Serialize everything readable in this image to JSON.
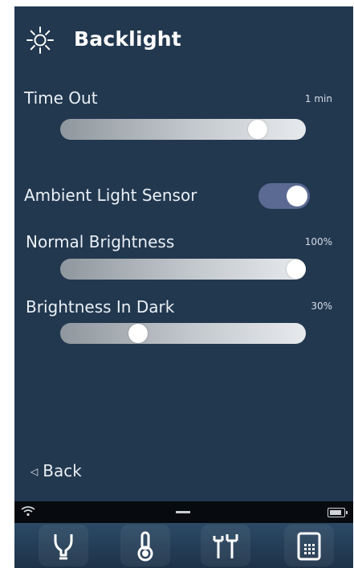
{
  "header": {
    "title": "Backlight",
    "icon": "sun-icon"
  },
  "settings": {
    "time_out": {
      "label": "Time Out",
      "value": "1 min",
      "level": 0.83
    },
    "ambient": {
      "label": "Ambient Light Sensor",
      "enabled": true
    },
    "normal_brightness": {
      "label": "Normal Brightness",
      "value": "100%",
      "level": 1.0
    },
    "dark_brightness": {
      "label": "Brightness In Dark",
      "value": "30%",
      "level": 0.3
    }
  },
  "footer": {
    "back_label": "Back"
  },
  "statusbar": {
    "icons": [
      "wifi-icon",
      "battery-icon"
    ]
  },
  "dock": {
    "icons": [
      "bulb-icon",
      "thermometer-icon",
      "probes-icon",
      "calculator-icon"
    ]
  },
  "colors": {
    "background": "#22384f",
    "toggle_on": "#5b6a92",
    "text": "#ffffff"
  }
}
